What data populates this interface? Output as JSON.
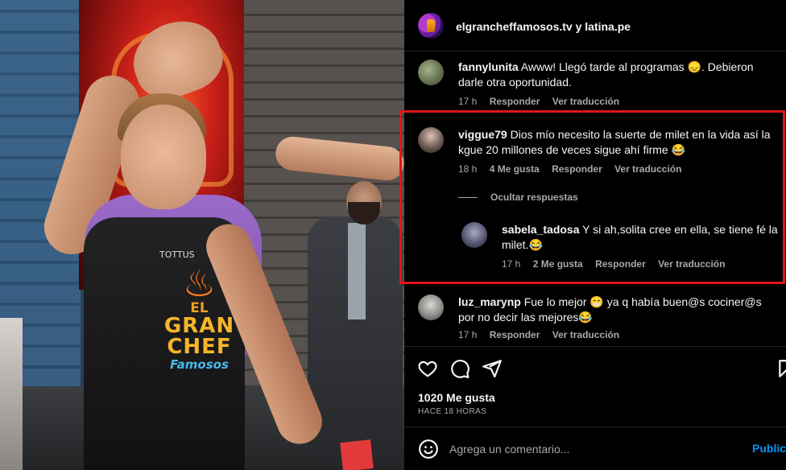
{
  "post": {
    "author_line": "elgrancheffamosos.tv y latina.pe",
    "apron_logo": {
      "brand": "TOTTUS",
      "line1": "EL",
      "line2": "GRAN",
      "line3": "CHEF",
      "line4": "Famosos"
    }
  },
  "comments": [
    {
      "user": "fannylunita",
      "text": "Awww! Llegó tarde al programas 😞. Debieron darle otra oportunidad.",
      "time": "17 h",
      "likes": "",
      "reply": "Responder",
      "translate": "Ver traducción"
    },
    {
      "user": "viggue79",
      "text": "Dios mío necesito la suerte de milet en la vida así la kgue 20 millones de veces sigue ahí firme 😂",
      "time": "18 h",
      "likes": "4 Me gusta",
      "reply": "Responder",
      "translate": "Ver traducción"
    },
    {
      "user": "sabela_tadosa",
      "text": "Y si ah,solita cree en ella, se tiene fé la milet.😂",
      "time": "17 h",
      "likes": "2 Me gusta",
      "reply": "Responder",
      "translate": "Ver traducción"
    },
    {
      "user": "luz_marynp",
      "text": "Fue lo mejor 😁 ya q había buen@s cociner@s por no decir las mejores😂",
      "time": "17 h",
      "likes": "",
      "reply": "Responder",
      "translate": "Ver traducción"
    }
  ],
  "replies_toggle": "Ocultar respuestas",
  "actions": {
    "likes_count": "1020 Me gusta",
    "posted": "HACE 18 HORAS",
    "icons": [
      "heart-icon",
      "comment-icon",
      "share-icon",
      "bookmark-icon"
    ]
  },
  "composer": {
    "placeholder": "Agrega un comentario...",
    "publish_label": "Publicar"
  },
  "colors": {
    "background": "#000000",
    "text": "#f5f5f5",
    "muted": "#a8a8a8",
    "highlight_box": "#e0161b",
    "publish": "#0095f6"
  }
}
